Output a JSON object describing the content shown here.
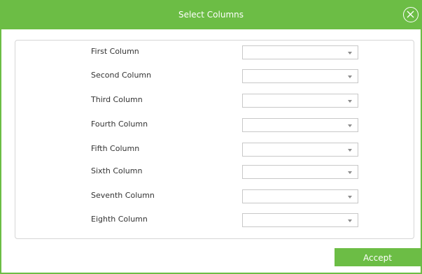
{
  "dialog": {
    "title": "Select Columns",
    "close_icon": "close-circle-icon",
    "accent_color": "#6cbd45"
  },
  "columns": [
    {
      "label": "First Column",
      "value": ""
    },
    {
      "label": "Second Column",
      "value": ""
    },
    {
      "label": "Third Column",
      "value": ""
    },
    {
      "label": "Fourth Column",
      "value": ""
    },
    {
      "label": "Fifth Column",
      "value": ""
    },
    {
      "label": "Sixth Column",
      "value": ""
    },
    {
      "label": "Seventh Column",
      "value": ""
    },
    {
      "label": "Eighth Column",
      "value": ""
    }
  ],
  "footer": {
    "accept_label": "Accept"
  }
}
